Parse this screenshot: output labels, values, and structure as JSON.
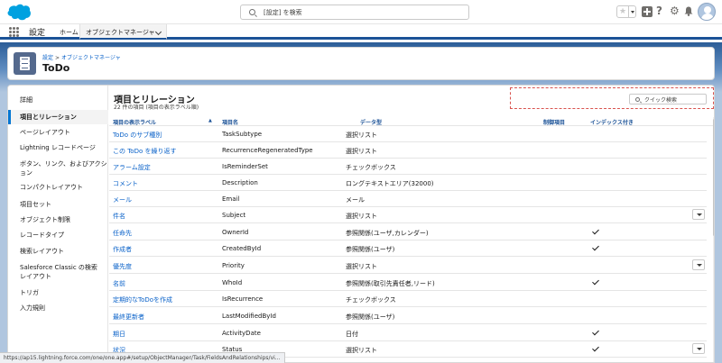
{
  "header": {
    "search_placeholder": "[設定] を検索",
    "icons": [
      "salesforce-cloud-logo",
      "search-icon",
      "favorites-star-icon",
      "add-icon",
      "help-icon",
      "gear-icon",
      "bell-icon",
      "avatar"
    ]
  },
  "nav": {
    "app_name": "設定",
    "home_tab": "ホーム",
    "object_manager_tab": "オブジェクトマネージャ"
  },
  "page_header": {
    "breadcrumb_setup": "設定",
    "breadcrumb_sep": ">",
    "breadcrumb_object_manager": "オブジェクトマネージャ",
    "title": "ToDo"
  },
  "sidebar": {
    "items": [
      {
        "label": "詳細",
        "active": false
      },
      {
        "label": "項目とリレーション",
        "active": true
      },
      {
        "label": "ページレイアウト",
        "active": false
      },
      {
        "label": "Lightning レコードページ",
        "active": false
      },
      {
        "label": "ボタン、リンク、およびアクション",
        "active": false
      },
      {
        "label": "コンパクトレイアウト",
        "active": false
      },
      {
        "label": "項目セット",
        "active": false
      },
      {
        "label": "オブジェクト制限",
        "active": false
      },
      {
        "label": "レコードタイプ",
        "active": false
      },
      {
        "label": "検索レイアウト",
        "active": false
      },
      {
        "label": "Salesforce Classic の検索レイアウト",
        "active": false
      },
      {
        "label": "トリガ",
        "active": false
      },
      {
        "label": "入力規則",
        "active": false
      }
    ]
  },
  "content": {
    "title": "項目とリレーション",
    "subtitle": "22 件の項目 (項目の表示ラベル順)",
    "quick_search_placeholder": "クイック検索",
    "columns": {
      "label": "項目の表示ラベル",
      "api": "項目名",
      "type": "データ型",
      "controlling": "制御項目",
      "indexed": "インデックス付き"
    },
    "rows": [
      {
        "label": "ToDo のサブ種別",
        "api": "TaskSubtype",
        "type": "選択リスト",
        "indexed": false,
        "action": false
      },
      {
        "label": "この ToDo を繰り返す",
        "api": "RecurrenceRegeneratedType",
        "type": "選択リスト",
        "indexed": false,
        "action": false
      },
      {
        "label": "アラーム設定",
        "api": "IsReminderSet",
        "type": "チェックボックス",
        "indexed": false,
        "action": false
      },
      {
        "label": "コメント",
        "api": "Description",
        "type": "ロングテキストエリア(32000)",
        "indexed": false,
        "action": false
      },
      {
        "label": "メール",
        "api": "Email",
        "type": "メール",
        "indexed": false,
        "action": false
      },
      {
        "label": "件名",
        "api": "Subject",
        "type": "選択リスト",
        "indexed": false,
        "action": true
      },
      {
        "label": "任命先",
        "api": "OwnerId",
        "type": "参照関係(ユーザ,カレンダー)",
        "indexed": true,
        "action": false
      },
      {
        "label": "作成者",
        "api": "CreatedById",
        "type": "参照関係(ユーザ)",
        "indexed": true,
        "action": false
      },
      {
        "label": "優先度",
        "api": "Priority",
        "type": "選択リスト",
        "indexed": false,
        "action": true
      },
      {
        "label": "名前",
        "api": "WhoId",
        "type": "参照関係(取引先責任者,リード)",
        "indexed": true,
        "action": false
      },
      {
        "label": "定期的なToDoを作成",
        "api": "IsRecurrence",
        "type": "チェックボックス",
        "indexed": false,
        "action": false
      },
      {
        "label": "最終更新者",
        "api": "LastModifiedById",
        "type": "参照関係(ユーザ)",
        "indexed": false,
        "action": false
      },
      {
        "label": "期日",
        "api": "ActivityDate",
        "type": "日付",
        "indexed": true,
        "action": false
      },
      {
        "label": "状況",
        "api": "Status",
        "type": "選択リスト",
        "indexed": true,
        "action": true
      }
    ]
  },
  "status_bar": {
    "url": "https://ap15.lightning.force.com/one/one.app#/setup/ObjectManager/Task/FieldsAndRelationships/vi..."
  },
  "colors": {
    "brand_blue": "#1b5297",
    "link_blue": "#0a62c9",
    "salesforce_cloud": "#00a1e0",
    "highlight_dashed": "#d9534f"
  }
}
